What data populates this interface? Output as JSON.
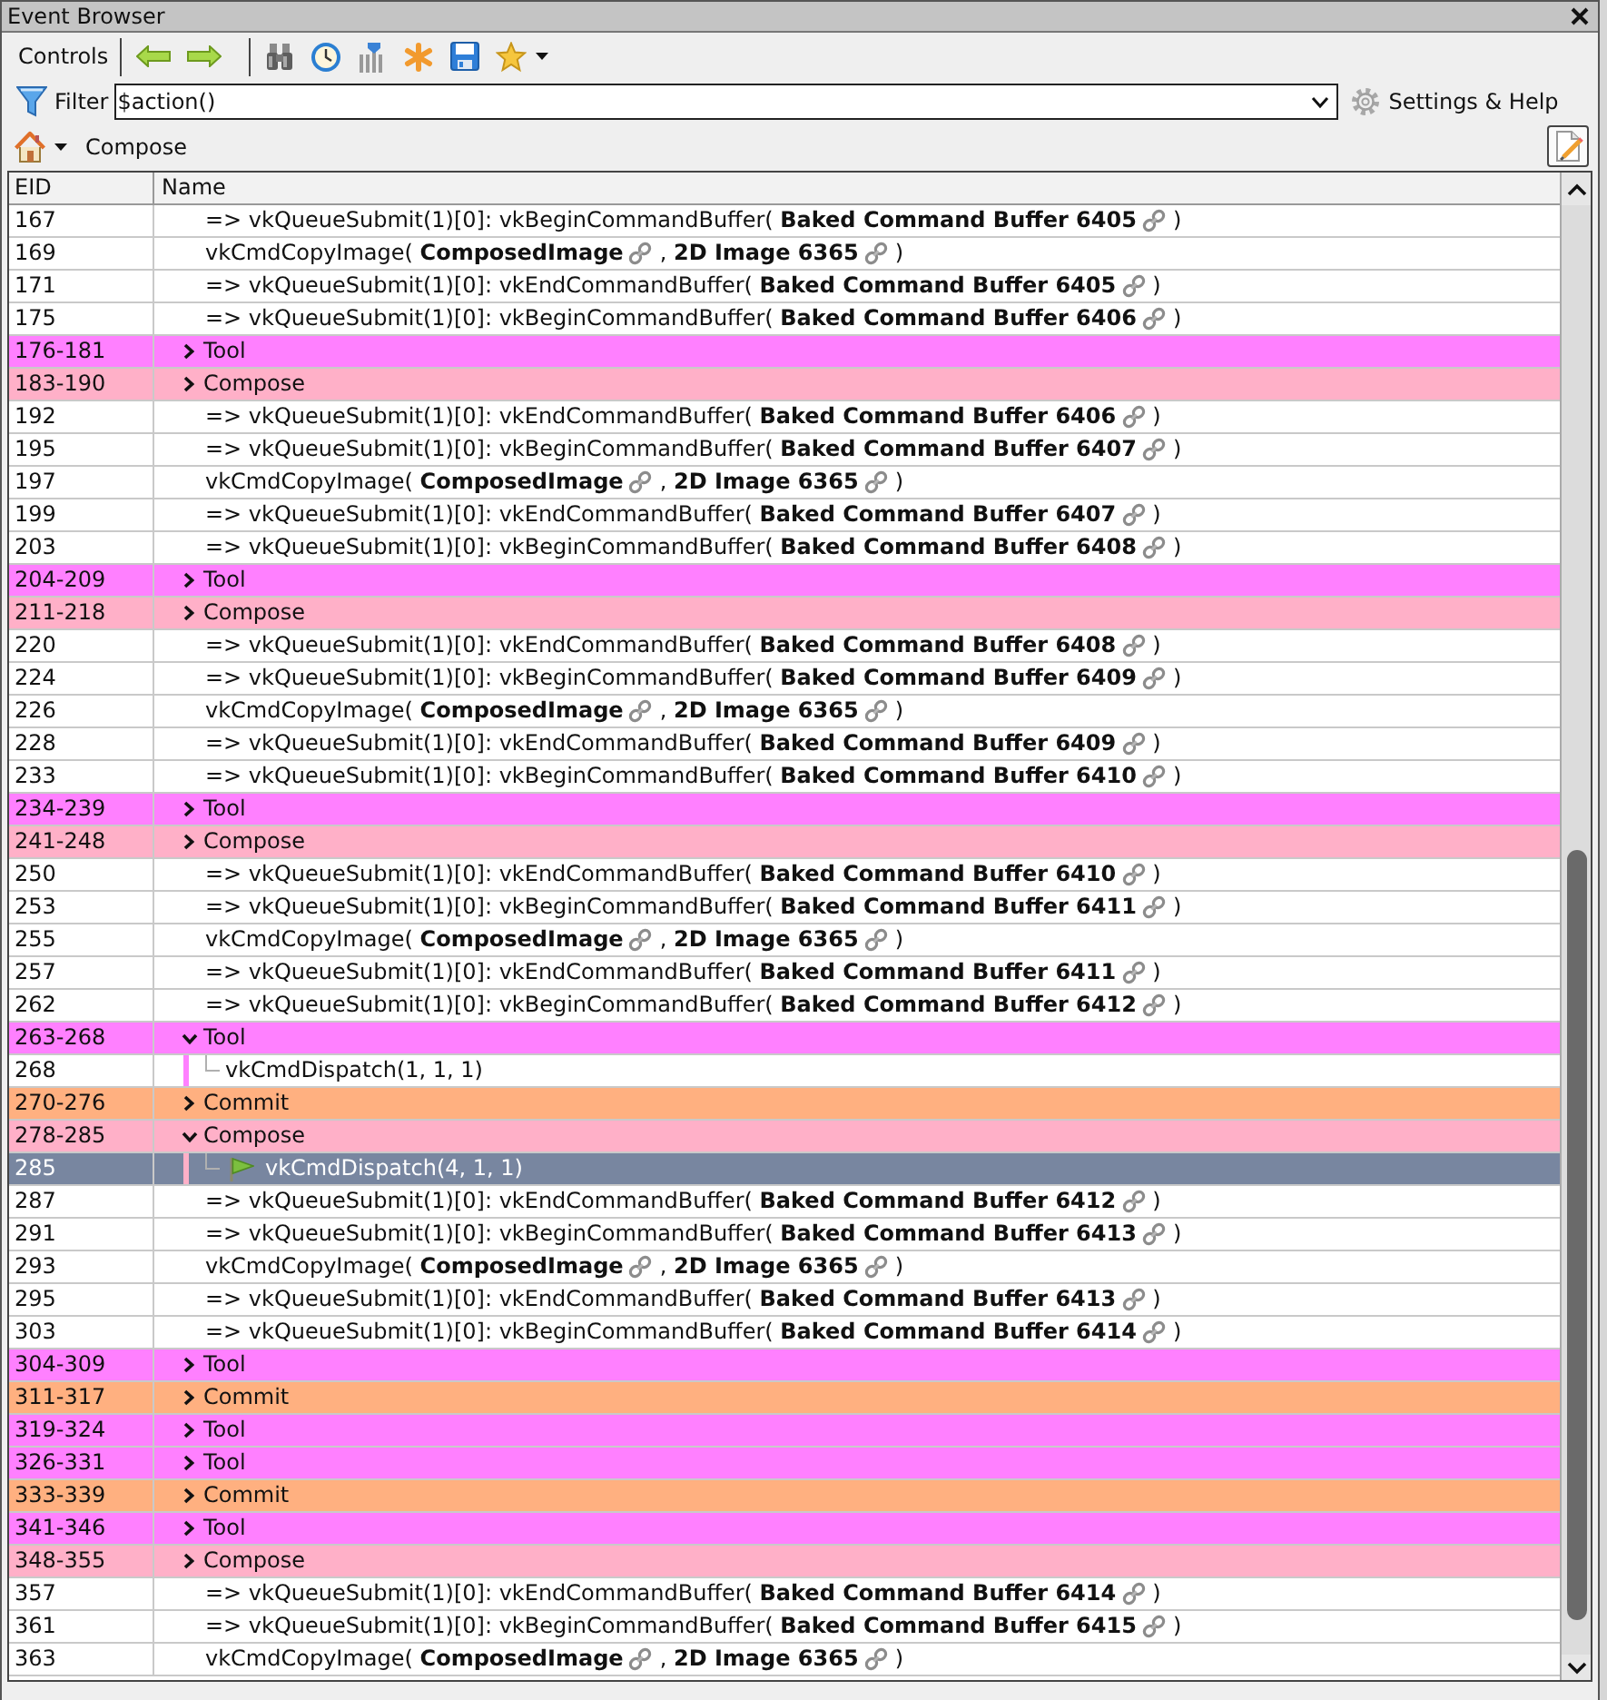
{
  "window": {
    "title": "Event Browser"
  },
  "toolbar": {
    "label": "Controls"
  },
  "filter": {
    "label": "Filter",
    "value": "$action()"
  },
  "settings": {
    "label": "Settings & Help"
  },
  "breadcrumb": {
    "label": "Compose"
  },
  "table": {
    "columns": [
      "EID",
      "Name"
    ],
    "rows": [
      {
        "eid": "167",
        "kind": "call",
        "selected": false,
        "current": false,
        "segments": [
          {
            "text": "=> vkQueueSubmit(1)[0]: vkBeginCommandBuffer( **Baked Command Buffer 6405**",
            "link": true
          },
          {
            "text": ")",
            "link": false
          }
        ]
      },
      {
        "eid": "169",
        "kind": "call",
        "selected": false,
        "current": false,
        "segments": [
          {
            "text": "vkCmdCopyImage( **ComposedImage**",
            "link": true
          },
          {
            "text": ", **2D Image 6365**",
            "link": true
          },
          {
            "text": ")",
            "link": false
          }
        ]
      },
      {
        "eid": "171",
        "kind": "call",
        "selected": false,
        "current": false,
        "segments": [
          {
            "text": "=> vkQueueSubmit(1)[0]: vkEndCommandBuffer( **Baked Command Buffer 6405**",
            "link": true
          },
          {
            "text": ")",
            "link": false
          }
        ]
      },
      {
        "eid": "175",
        "kind": "call",
        "selected": false,
        "current": false,
        "segments": [
          {
            "text": "=> vkQueueSubmit(1)[0]: vkBeginCommandBuffer( **Baked Command Buffer 6406**",
            "link": true
          },
          {
            "text": ")",
            "link": false
          }
        ]
      },
      {
        "eid": "176-181",
        "kind": "marker",
        "selected": false,
        "current": false,
        "label": "Tool",
        "color": "#ff80ff",
        "expanded": false
      },
      {
        "eid": "183-190",
        "kind": "marker",
        "selected": false,
        "current": false,
        "label": "Compose",
        "color": "#ffb0c8",
        "expanded": false
      },
      {
        "eid": "192",
        "kind": "call",
        "selected": false,
        "current": false,
        "segments": [
          {
            "text": "=> vkQueueSubmit(1)[0]: vkEndCommandBuffer( **Baked Command Buffer 6406**",
            "link": true
          },
          {
            "text": ")",
            "link": false
          }
        ]
      },
      {
        "eid": "195",
        "kind": "call",
        "selected": false,
        "current": false,
        "segments": [
          {
            "text": "=> vkQueueSubmit(1)[0]: vkBeginCommandBuffer( **Baked Command Buffer 6407**",
            "link": true
          },
          {
            "text": ")",
            "link": false
          }
        ]
      },
      {
        "eid": "197",
        "kind": "call",
        "selected": false,
        "current": false,
        "segments": [
          {
            "text": "vkCmdCopyImage( **ComposedImage**",
            "link": true
          },
          {
            "text": ", **2D Image 6365**",
            "link": true
          },
          {
            "text": ")",
            "link": false
          }
        ]
      },
      {
        "eid": "199",
        "kind": "call",
        "selected": false,
        "current": false,
        "segments": [
          {
            "text": "=> vkQueueSubmit(1)[0]: vkEndCommandBuffer( **Baked Command Buffer 6407**",
            "link": true
          },
          {
            "text": ")",
            "link": false
          }
        ]
      },
      {
        "eid": "203",
        "kind": "call",
        "selected": false,
        "current": false,
        "segments": [
          {
            "text": "=> vkQueueSubmit(1)[0]: vkBeginCommandBuffer( **Baked Command Buffer 6408**",
            "link": true
          },
          {
            "text": ")",
            "link": false
          }
        ]
      },
      {
        "eid": "204-209",
        "kind": "marker",
        "selected": false,
        "current": false,
        "label": "Tool",
        "color": "#ff80ff",
        "expanded": false
      },
      {
        "eid": "211-218",
        "kind": "marker",
        "selected": false,
        "current": false,
        "label": "Compose",
        "color": "#ffb0c8",
        "expanded": false
      },
      {
        "eid": "220",
        "kind": "call",
        "selected": false,
        "current": false,
        "segments": [
          {
            "text": "=> vkQueueSubmit(1)[0]: vkEndCommandBuffer( **Baked Command Buffer 6408**",
            "link": true
          },
          {
            "text": ")",
            "link": false
          }
        ]
      },
      {
        "eid": "224",
        "kind": "call",
        "selected": false,
        "current": false,
        "segments": [
          {
            "text": "=> vkQueueSubmit(1)[0]: vkBeginCommandBuffer( **Baked Command Buffer 6409**",
            "link": true
          },
          {
            "text": ")",
            "link": false
          }
        ]
      },
      {
        "eid": "226",
        "kind": "call",
        "selected": false,
        "current": false,
        "segments": [
          {
            "text": "vkCmdCopyImage( **ComposedImage**",
            "link": true
          },
          {
            "text": ", **2D Image 6365**",
            "link": true
          },
          {
            "text": ")",
            "link": false
          }
        ]
      },
      {
        "eid": "228",
        "kind": "call",
        "selected": false,
        "current": false,
        "segments": [
          {
            "text": "=> vkQueueSubmit(1)[0]: vkEndCommandBuffer( **Baked Command Buffer 6409**",
            "link": true
          },
          {
            "text": ")",
            "link": false
          }
        ]
      },
      {
        "eid": "233",
        "kind": "call",
        "selected": false,
        "current": false,
        "segments": [
          {
            "text": "=> vkQueueSubmit(1)[0]: vkBeginCommandBuffer( **Baked Command Buffer 6410**",
            "link": true
          },
          {
            "text": ")",
            "link": false
          }
        ]
      },
      {
        "eid": "234-239",
        "kind": "marker",
        "selected": false,
        "current": false,
        "label": "Tool",
        "color": "#ff80ff",
        "expanded": false
      },
      {
        "eid": "241-248",
        "kind": "marker",
        "selected": false,
        "current": false,
        "label": "Compose",
        "color": "#ffb0c8",
        "expanded": false
      },
      {
        "eid": "250",
        "kind": "call",
        "selected": false,
        "current": false,
        "segments": [
          {
            "text": "=> vkQueueSubmit(1)[0]: vkEndCommandBuffer( **Baked Command Buffer 6410**",
            "link": true
          },
          {
            "text": ")",
            "link": false
          }
        ]
      },
      {
        "eid": "253",
        "kind": "call",
        "selected": false,
        "current": false,
        "segments": [
          {
            "text": "=> vkQueueSubmit(1)[0]: vkBeginCommandBuffer( **Baked Command Buffer 6411**",
            "link": true
          },
          {
            "text": ")",
            "link": false
          }
        ]
      },
      {
        "eid": "255",
        "kind": "call",
        "selected": false,
        "current": false,
        "segments": [
          {
            "text": "vkCmdCopyImage( **ComposedImage**",
            "link": true
          },
          {
            "text": ", **2D Image 6365**",
            "link": true
          },
          {
            "text": ")",
            "link": false
          }
        ]
      },
      {
        "eid": "257",
        "kind": "call",
        "selected": false,
        "current": false,
        "segments": [
          {
            "text": "=> vkQueueSubmit(1)[0]: vkEndCommandBuffer( **Baked Command Buffer 6411**",
            "link": true
          },
          {
            "text": ")",
            "link": false
          }
        ]
      },
      {
        "eid": "262",
        "kind": "call",
        "selected": false,
        "current": false,
        "segments": [
          {
            "text": "=> vkQueueSubmit(1)[0]: vkBeginCommandBuffer( **Baked Command Buffer 6412**",
            "link": true
          },
          {
            "text": ")",
            "link": false
          }
        ]
      },
      {
        "eid": "263-268",
        "kind": "marker",
        "selected": false,
        "current": false,
        "label": "Tool",
        "color": "#ff80ff",
        "expanded": true,
        "children": [
          {
            "eid": "268",
            "kind": "call",
            "selected": false,
            "current": false,
            "segments": [
              {
                "text": "vkCmdDispatch(1, 1, 1)",
                "link": false
              }
            ]
          }
        ]
      },
      {
        "eid": "270-276",
        "kind": "marker",
        "selected": false,
        "current": false,
        "label": "Commit",
        "color": "#ffb080",
        "expanded": false
      },
      {
        "eid": "278-285",
        "kind": "marker",
        "selected": false,
        "current": false,
        "label": "Compose",
        "color": "#ffb0c8",
        "expanded": true,
        "children": [
          {
            "eid": "285",
            "kind": "call",
            "selected": true,
            "current": true,
            "segments": [
              {
                "text": "vkCmdDispatch(4, 1, 1)",
                "link": false
              }
            ]
          }
        ]
      },
      {
        "eid": "287",
        "kind": "call",
        "selected": false,
        "current": false,
        "segments": [
          {
            "text": "=> vkQueueSubmit(1)[0]: vkEndCommandBuffer( **Baked Command Buffer 6412**",
            "link": true
          },
          {
            "text": ")",
            "link": false
          }
        ]
      },
      {
        "eid": "291",
        "kind": "call",
        "selected": false,
        "current": false,
        "segments": [
          {
            "text": "=> vkQueueSubmit(1)[0]: vkBeginCommandBuffer( **Baked Command Buffer 6413**",
            "link": true
          },
          {
            "text": ")",
            "link": false
          }
        ]
      },
      {
        "eid": "293",
        "kind": "call",
        "selected": false,
        "current": false,
        "segments": [
          {
            "text": "vkCmdCopyImage( **ComposedImage**",
            "link": true
          },
          {
            "text": ", **2D Image 6365**",
            "link": true
          },
          {
            "text": ")",
            "link": false
          }
        ]
      },
      {
        "eid": "295",
        "kind": "call",
        "selected": false,
        "current": false,
        "segments": [
          {
            "text": "=> vkQueueSubmit(1)[0]: vkEndCommandBuffer( **Baked Command Buffer 6413**",
            "link": true
          },
          {
            "text": ")",
            "link": false
          }
        ]
      },
      {
        "eid": "303",
        "kind": "call",
        "selected": false,
        "current": false,
        "segments": [
          {
            "text": "=> vkQueueSubmit(1)[0]: vkBeginCommandBuffer( **Baked Command Buffer 6414**",
            "link": true
          },
          {
            "text": ")",
            "link": false
          }
        ]
      },
      {
        "eid": "304-309",
        "kind": "marker",
        "selected": false,
        "current": false,
        "label": "Tool",
        "color": "#ff80ff",
        "expanded": false
      },
      {
        "eid": "311-317",
        "kind": "marker",
        "selected": false,
        "current": false,
        "label": "Commit",
        "color": "#ffb080",
        "expanded": false
      },
      {
        "eid": "319-324",
        "kind": "marker",
        "selected": false,
        "current": false,
        "label": "Tool",
        "color": "#ff80ff",
        "expanded": false
      },
      {
        "eid": "326-331",
        "kind": "marker",
        "selected": false,
        "current": false,
        "label": "Tool",
        "color": "#ff80ff",
        "expanded": false
      },
      {
        "eid": "333-339",
        "kind": "marker",
        "selected": false,
        "current": false,
        "label": "Commit",
        "color": "#ffb080",
        "expanded": false
      },
      {
        "eid": "341-346",
        "kind": "marker",
        "selected": false,
        "current": false,
        "label": "Tool",
        "color": "#ff80ff",
        "expanded": false
      },
      {
        "eid": "348-355",
        "kind": "marker",
        "selected": false,
        "current": false,
        "label": "Compose",
        "color": "#ffb0c8",
        "expanded": false
      },
      {
        "eid": "357",
        "kind": "call",
        "selected": false,
        "current": false,
        "segments": [
          {
            "text": "=> vkQueueSubmit(1)[0]: vkEndCommandBuffer( **Baked Command Buffer 6414**",
            "link": true
          },
          {
            "text": ")",
            "link": false
          }
        ]
      },
      {
        "eid": "361",
        "kind": "call",
        "selected": false,
        "current": false,
        "segments": [
          {
            "text": "=> vkQueueSubmit(1)[0]: vkBeginCommandBuffer( **Baked Command Buffer 6415**",
            "link": true
          },
          {
            "text": ")",
            "link": false
          }
        ]
      },
      {
        "eid": "363",
        "kind": "call",
        "selected": false,
        "current": false,
        "segments": [
          {
            "text": "vkCmdCopyImage( **ComposedImage**",
            "link": true
          },
          {
            "text": ", **2D Image 6365**",
            "link": true
          },
          {
            "text": ")",
            "link": false
          }
        ]
      }
    ]
  }
}
